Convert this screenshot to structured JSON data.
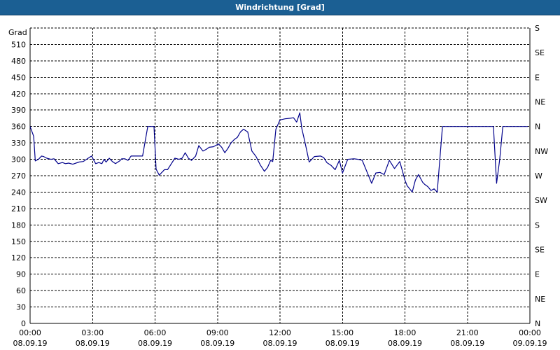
{
  "window": {
    "title": "Windrichtung [Grad]"
  },
  "colors": {
    "titlebar": "#1b5f93",
    "line": "#00008b",
    "grid": "#000000"
  },
  "chart_data": {
    "type": "line",
    "title": "Windrichtung [Grad]",
    "ylabel": "Grad",
    "ylim": [
      0,
      540
    ],
    "yticks": [
      0,
      30,
      60,
      90,
      120,
      150,
      180,
      210,
      240,
      270,
      300,
      330,
      360,
      390,
      420,
      450,
      480,
      510
    ],
    "y2_ticks": [
      {
        "value": 0,
        "label": "N"
      },
      {
        "value": 45,
        "label": "NE"
      },
      {
        "value": 90,
        "label": "E"
      },
      {
        "value": 135,
        "label": "SE"
      },
      {
        "value": 180,
        "label": "S"
      },
      {
        "value": 225,
        "label": "SW"
      },
      {
        "value": 270,
        "label": "W"
      },
      {
        "value": 315,
        "label": "NW"
      },
      {
        "value": 360,
        "label": "N"
      },
      {
        "value": 405,
        "label": "NE"
      },
      {
        "value": 450,
        "label": "E"
      },
      {
        "value": 495,
        "label": "SE"
      },
      {
        "value": 540,
        "label": "S"
      }
    ],
    "xlim": [
      0,
      24
    ],
    "xticks": [
      {
        "hour": 0,
        "time": "00:00",
        "date": "08.09.19"
      },
      {
        "hour": 3,
        "time": "03:00",
        "date": "08.09.19"
      },
      {
        "hour": 6,
        "time": "06:00",
        "date": "08.09.19"
      },
      {
        "hour": 9,
        "time": "09:00",
        "date": "08.09.19"
      },
      {
        "hour": 12,
        "time": "12:00",
        "date": "08.09.19"
      },
      {
        "hour": 15,
        "time": "15:00",
        "date": "08.09.19"
      },
      {
        "hour": 18,
        "time": "18:00",
        "date": "08.09.19"
      },
      {
        "hour": 21,
        "time": "21:00",
        "date": "08.09.19"
      },
      {
        "hour": 24,
        "time": "00:00",
        "date": "09.09.19"
      }
    ],
    "grid": true,
    "series": [
      {
        "x": [
          0.0,
          0.17,
          0.25,
          0.4,
          0.55,
          0.65,
          0.8,
          1.0,
          1.15,
          1.35,
          1.55,
          1.7,
          1.85,
          2.05,
          2.35,
          2.55,
          2.75,
          2.95,
          3.05,
          3.15,
          3.3,
          3.45,
          3.55,
          3.65,
          3.8,
          3.95,
          4.1,
          4.3,
          4.4,
          4.55,
          4.7,
          4.85,
          5.15,
          5.4,
          5.65,
          5.8,
          5.95,
          6.05,
          6.2,
          6.45,
          6.6,
          6.75,
          6.95,
          7.15,
          7.3,
          7.45,
          7.6,
          7.75,
          7.95,
          8.1,
          8.3,
          8.45,
          8.6,
          8.8,
          9.05,
          9.2,
          9.35,
          9.5,
          9.65,
          9.8,
          9.95,
          10.1,
          10.25,
          10.45,
          10.65,
          10.85,
          11.05,
          11.25,
          11.4,
          11.55,
          11.65,
          11.8,
          12.0,
          12.25,
          12.5,
          12.65,
          12.8,
          12.95,
          13.05,
          13.2,
          13.4,
          13.65,
          13.95,
          14.1,
          14.25,
          14.45,
          14.65,
          14.85,
          15.0,
          15.25,
          15.55,
          15.75,
          15.95,
          16.2,
          16.4,
          16.6,
          16.8,
          17.0,
          17.25,
          17.5,
          17.75,
          18.0,
          18.1,
          18.35,
          18.5,
          18.65,
          18.85,
          18.95,
          19.1,
          19.25,
          19.4,
          19.55,
          19.8,
          20.3,
          20.8,
          21.3,
          21.8,
          22.15,
          22.25,
          22.4,
          22.55,
          22.7,
          23.0,
          23.5,
          23.9
        ],
        "y": [
          360,
          342,
          297,
          300,
          306,
          305,
          302,
          300,
          301,
          292,
          294,
          292,
          293,
          291,
          295,
          296,
          301,
          306,
          299,
          292,
          294,
          292,
          300,
          295,
          302,
          296,
          292,
          297,
          301,
          301,
          298,
          306,
          306,
          306,
          360,
          360,
          360,
          282,
          271,
          281,
          281,
          290,
          302,
          300,
          302,
          312,
          302,
          298,
          306,
          325,
          315,
          318,
          322,
          323,
          328,
          322,
          312,
          320,
          330,
          336,
          340,
          350,
          355,
          350,
          315,
          305,
          290,
          278,
          285,
          298,
          296,
          355,
          372,
          374,
          375,
          376,
          368,
          385,
          356,
          331,
          295,
          305,
          306,
          303,
          294,
          289,
          281,
          298,
          275,
          300,
          301,
          300,
          298,
          275,
          256,
          275,
          276,
          272,
          298,
          283,
          296,
          262,
          252,
          240,
          262,
          272,
          258,
          254,
          250,
          243,
          246,
          240,
          360,
          360,
          360,
          360,
          360,
          360,
          360,
          256,
          300,
          360,
          360,
          360,
          360
        ]
      }
    ]
  }
}
